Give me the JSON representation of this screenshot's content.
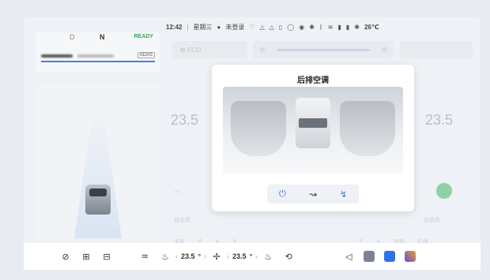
{
  "status_bar": {
    "time": "12:42",
    "weekday": "星期三",
    "account": "未登录",
    "temperature": "26℃"
  },
  "cluster": {
    "gear": "D",
    "mode": "N",
    "ready": "READY",
    "adas": "ADAS"
  },
  "climate": {
    "eco": "ECO",
    "left_temp": "23.5",
    "right_temp": "23.5",
    "left_wind": "自由风",
    "right_wind": "自由风",
    "quick_left": "主驾",
    "quick_right": "副驾",
    "quick_far_right": "后排"
  },
  "popup": {
    "title": "后排空调"
  },
  "dock": {
    "left_temp": "23.5",
    "right_temp": "23.5",
    "temp_unit": "°"
  },
  "colors": {
    "accent_blue": "#3b73e0",
    "ready_green": "#3aa55a"
  }
}
